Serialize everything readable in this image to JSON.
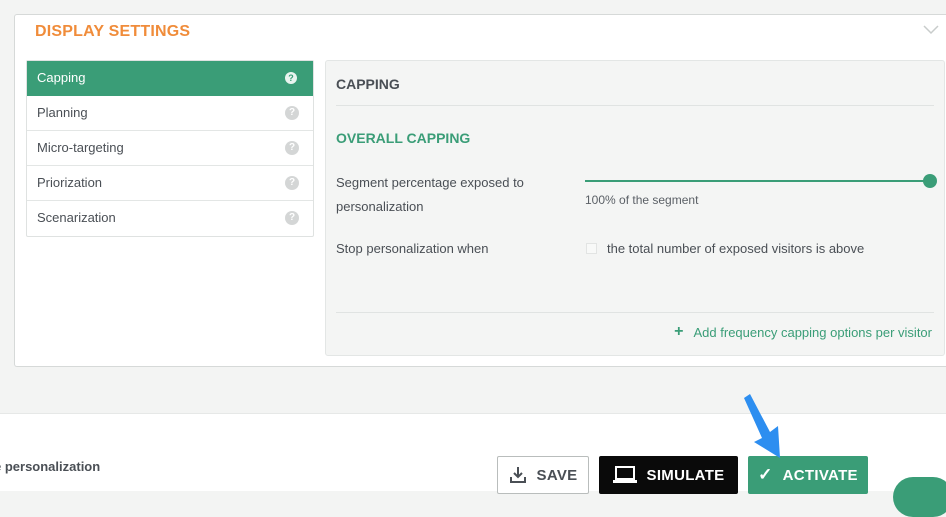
{
  "panel": {
    "title": "DISPLAY SETTINGS"
  },
  "nav": {
    "items": [
      {
        "label": "Capping",
        "active": true,
        "help": "?"
      },
      {
        "label": "Planning",
        "active": false,
        "help": "?"
      },
      {
        "label": "Micro-targeting",
        "active": false,
        "help": "?"
      },
      {
        "label": "Priorization",
        "active": false,
        "help": "?"
      },
      {
        "label": "Scenarization",
        "active": false,
        "help": "?"
      }
    ]
  },
  "content": {
    "title": "CAPPING",
    "section_title": "OVERALL CAPPING",
    "segment_label": "Segment percentage exposed to personalization",
    "segment_value_text": "100% of the segment",
    "segment_percent": 100,
    "stop_label": "Stop personalization when",
    "stop_checkbox_label": "the total number of exposed visitors is above",
    "stop_checked": false,
    "add_link": "Add frequency capping options per visitor"
  },
  "footer": {
    "label": "e personalization",
    "save": "SAVE",
    "simulate": "SIMULATE",
    "activate": "ACTIVATE"
  },
  "colors": {
    "accent": "#3a9d77",
    "title_orange": "#f08c3a",
    "arrow_blue": "#2d8ef0"
  },
  "icons": {
    "collapse": "chevron-down-icon",
    "help": "help-icon",
    "save": "download-icon",
    "simulate": "laptop-icon",
    "activate": "check-icon",
    "add": "plus-icon"
  }
}
